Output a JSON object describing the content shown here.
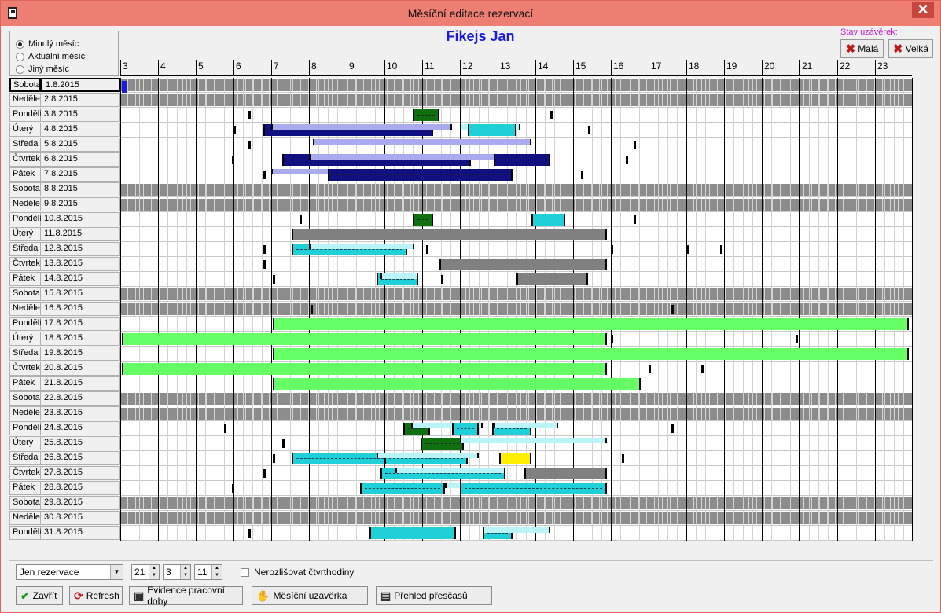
{
  "window": {
    "title": "Měsíční editace rezervací",
    "close_label": "✕"
  },
  "period": {
    "options": [
      {
        "label": "Minulý měsíc",
        "selected": true
      },
      {
        "label": "Aktuální měsíc",
        "selected": false
      },
      {
        "label": "Jiný měsíc",
        "selected": false
      }
    ]
  },
  "person": "Fikejs Jan",
  "closure": {
    "label": "Stav uzávěrek:",
    "small_label": "Malá",
    "big_label": "Velká"
  },
  "hours": [
    "3",
    "4",
    "5",
    "6",
    "7",
    "8",
    "9",
    "10",
    "11",
    "12",
    "13",
    "14",
    "15",
    "16",
    "17",
    "18",
    "19",
    "20",
    "21",
    "22",
    "23"
  ],
  "days": [
    {
      "name": "Sobota",
      "date": "1.8.2015",
      "weekend": true,
      "selected": true
    },
    {
      "name": "Neděle",
      "date": "2.8.2015",
      "weekend": true
    },
    {
      "name": "Pondělí",
      "date": "3.8.2015"
    },
    {
      "name": "Úterý",
      "date": "4.8.2015"
    },
    {
      "name": "Středa",
      "date": "5.8.2015"
    },
    {
      "name": "Čtvrtek",
      "date": "6.8.2015"
    },
    {
      "name": "Pátek",
      "date": "7.8.2015"
    },
    {
      "name": "Sobota",
      "date": "8.8.2015",
      "weekend": true
    },
    {
      "name": "Neděle",
      "date": "9.8.2015",
      "weekend": true
    },
    {
      "name": "Pondělí",
      "date": "10.8.2015"
    },
    {
      "name": "Úterý",
      "date": "11.8.2015"
    },
    {
      "name": "Středa",
      "date": "12.8.2015"
    },
    {
      "name": "Čtvrtek",
      "date": "13.8.2015"
    },
    {
      "name": "Pátek",
      "date": "14.8.2015"
    },
    {
      "name": "Sobota",
      "date": "15.8.2015",
      "weekend": true
    },
    {
      "name": "Neděle",
      "date": "16.8.2015",
      "weekend": true
    },
    {
      "name": "Pondělí",
      "date": "17.8.2015"
    },
    {
      "name": "Úterý",
      "date": "18.8.2015"
    },
    {
      "name": "Středa",
      "date": "19.8.2015"
    },
    {
      "name": "Čtvrtek",
      "date": "20.8.2015"
    },
    {
      "name": "Pátek",
      "date": "21.8.2015"
    },
    {
      "name": "Sobota",
      "date": "22.8.2015",
      "weekend": true
    },
    {
      "name": "Neděle",
      "date": "23.8.2015",
      "weekend": true
    },
    {
      "name": "Pondělí",
      "date": "24.8.2015"
    },
    {
      "name": "Úterý",
      "date": "25.8.2015"
    },
    {
      "name": "Středa",
      "date": "26.8.2015"
    },
    {
      "name": "Čtvrtek",
      "date": "27.8.2015"
    },
    {
      "name": "Pátek",
      "date": "28.8.2015"
    },
    {
      "name": "Sobota",
      "date": "29.8.2015",
      "weekend": true
    },
    {
      "name": "Neděle",
      "date": "30.8.2015",
      "weekend": true
    },
    {
      "name": "Pondělí",
      "date": "31.8.2015"
    }
  ],
  "colors": {
    "weekend": "#8c8c8c",
    "reservation": "#101080",
    "reservation_light": "#aaaaee",
    "closure": "#808080",
    "cyan": "#20d0d8",
    "cyan_light": "#b8f4f8",
    "green_dark": "#107010",
    "green_light": "#66ff66",
    "yellow": "#ffee00"
  },
  "bars": [
    {
      "day": 2,
      "from": 10.75,
      "to": 11.45,
      "color": "#107010",
      "dashed": true
    },
    {
      "day": 3,
      "from": 6.8,
      "to": 11.3,
      "color": "#101080",
      "dashed": true
    },
    {
      "day": 3,
      "from": 7.0,
      "to": 11.8,
      "color": "#aaaaee",
      "thin": true
    },
    {
      "day": 3,
      "from": 12.0,
      "to": 13.6,
      "color": "#b8f4f8",
      "thin": true
    },
    {
      "day": 3,
      "from": 12.2,
      "to": 13.5,
      "color": "#20d0d8",
      "dashed": true
    },
    {
      "day": 4,
      "from": 8.1,
      "to": 13.9,
      "color": "#aaaaee",
      "thin": true
    },
    {
      "day": 5,
      "from": 7.3,
      "to": 12.3,
      "color": "#101080",
      "dashed": true
    },
    {
      "day": 5,
      "from": 8.0,
      "to": 13.9,
      "color": "#aaaaee",
      "thin": true
    },
    {
      "day": 5,
      "from": 12.9,
      "to": 14.4,
      "color": "#101080"
    },
    {
      "day": 6,
      "from": 7.0,
      "to": 12.0,
      "color": "#aaaaee",
      "thin": true
    },
    {
      "day": 6,
      "from": 8.5,
      "to": 13.4,
      "color": "#101080",
      "dashed": true
    },
    {
      "day": 9,
      "from": 10.75,
      "to": 11.3,
      "color": "#107010",
      "dashed": true
    },
    {
      "day": 9,
      "from": 13.9,
      "to": 14.8,
      "color": "#20d0d8"
    },
    {
      "day": 10,
      "from": 7.55,
      "to": 15.9,
      "color": "#808080"
    },
    {
      "day": 11,
      "from": 7.55,
      "to": 10.6,
      "color": "#20d0d8",
      "dashed": true
    },
    {
      "day": 11,
      "from": 8.0,
      "to": 10.8,
      "color": "#b8f4f8",
      "thin": true
    },
    {
      "day": 12,
      "from": 11.45,
      "to": 15.9,
      "color": "#808080"
    },
    {
      "day": 13,
      "from": 9.8,
      "to": 10.9,
      "color": "#20d0d8",
      "dashed": true
    },
    {
      "day": 13,
      "from": 9.9,
      "to": 10.9,
      "color": "#b8f4f8",
      "thin": true
    },
    {
      "day": 13,
      "from": 13.5,
      "to": 15.4,
      "color": "#808080"
    },
    {
      "day": 16,
      "from": 7.05,
      "to": 23.9,
      "color": "#66ff66"
    },
    {
      "day": 17,
      "from": 3.05,
      "to": 15.9,
      "color": "#66ff66"
    },
    {
      "day": 18,
      "from": 7.05,
      "to": 23.9,
      "color": "#66ff66"
    },
    {
      "day": 19,
      "from": 3.05,
      "to": 15.9,
      "color": "#66ff66"
    },
    {
      "day": 20,
      "from": 7.05,
      "to": 16.8,
      "color": "#66ff66"
    },
    {
      "day": 23,
      "from": 10.5,
      "to": 11.2,
      "color": "#107010",
      "dashed": true
    },
    {
      "day": 23,
      "from": 10.7,
      "to": 12.6,
      "color": "#b8f4f8",
      "thin": true
    },
    {
      "day": 23,
      "from": 11.8,
      "to": 12.5,
      "color": "#20d0d8",
      "dashed": true
    },
    {
      "day": 23,
      "from": 12.85,
      "to": 13.9,
      "color": "#20d0d8",
      "dashed": true
    },
    {
      "day": 23,
      "from": 12.9,
      "to": 14.6,
      "color": "#b8f4f8",
      "thin": true
    },
    {
      "day": 24,
      "from": 10.95,
      "to": 12.1,
      "color": "#107010",
      "dashed": true
    },
    {
      "day": 24,
      "from": 12.0,
      "to": 15.9,
      "color": "#b8f4f8",
      "thin": true
    },
    {
      "day": 25,
      "from": 7.55,
      "to": 10.1,
      "color": "#20d0d8",
      "dashed": true
    },
    {
      "day": 25,
      "from": 10.0,
      "to": 12.2,
      "color": "#20d0d8",
      "dashed": true
    },
    {
      "day": 25,
      "from": 9.8,
      "to": 12.5,
      "color": "#b8f4f8",
      "thin": true
    },
    {
      "day": 25,
      "from": 13.05,
      "to": 13.9,
      "color": "#ffee00"
    },
    {
      "day": 26,
      "from": 9.9,
      "to": 13.2,
      "color": "#20d0d8",
      "dashed": true
    },
    {
      "day": 26,
      "from": 10.3,
      "to": 13.2,
      "color": "#b8f4f8",
      "thin": true
    },
    {
      "day": 26,
      "from": 13.7,
      "to": 15.9,
      "color": "#808080"
    },
    {
      "day": 27,
      "from": 9.35,
      "to": 11.6,
      "color": "#20d0d8",
      "dashed": true
    },
    {
      "day": 27,
      "from": 11.6,
      "to": 13.9,
      "color": "#b8f4f8",
      "thin": true
    },
    {
      "day": 27,
      "from": 12.0,
      "to": 15.9,
      "color": "#20d0d8",
      "dashed": true
    },
    {
      "day": 30,
      "from": 9.6,
      "to": 11.9,
      "color": "#20d0d8"
    },
    {
      "day": 30,
      "from": 12.6,
      "to": 13.4,
      "color": "#20d0d8",
      "dashed": true
    },
    {
      "day": 30,
      "from": 12.6,
      "to": 14.4,
      "color": "#b8f4f8",
      "thin": true
    }
  ],
  "marks": [
    {
      "day": 0,
      "at": 3.05,
      "color": "#1a1ae6"
    },
    {
      "day": 2,
      "at": 6.4
    },
    {
      "day": 2,
      "at": 14.4
    },
    {
      "day": 3,
      "at": 6.0
    },
    {
      "day": 3,
      "at": 15.4
    },
    {
      "day": 4,
      "at": 6.4
    },
    {
      "day": 4,
      "at": 16.6
    },
    {
      "day": 5,
      "at": 5.95
    },
    {
      "day": 5,
      "at": 16.4
    },
    {
      "day": 6,
      "at": 6.8
    },
    {
      "day": 6,
      "at": 15.2
    },
    {
      "day": 9,
      "at": 7.75
    },
    {
      "day": 9,
      "at": 16.6
    },
    {
      "day": 11,
      "at": 6.8
    },
    {
      "day": 11,
      "at": 11.1
    },
    {
      "day": 11,
      "at": 16.0
    },
    {
      "day": 11,
      "at": 18.0
    },
    {
      "day": 11,
      "at": 18.9
    },
    {
      "day": 12,
      "at": 6.8
    },
    {
      "day": 13,
      "at": 7.05
    },
    {
      "day": 13,
      "at": 11.5
    },
    {
      "day": 15,
      "at": 8.05
    },
    {
      "day": 15,
      "at": 17.6
    },
    {
      "day": 17,
      "at": 16.0
    },
    {
      "day": 17,
      "at": 20.9
    },
    {
      "day": 19,
      "at": 17.0
    },
    {
      "day": 19,
      "at": 18.4
    },
    {
      "day": 23,
      "at": 5.75
    },
    {
      "day": 23,
      "at": 17.6
    },
    {
      "day": 24,
      "at": 7.3
    },
    {
      "day": 25,
      "at": 7.05
    },
    {
      "day": 25,
      "at": 16.3
    },
    {
      "day": 26,
      "at": 6.8
    },
    {
      "day": 27,
      "at": 5.95
    },
    {
      "day": 30,
      "at": 6.4
    }
  ],
  "controls": {
    "view": "Jen rezervace",
    "spin1": "21",
    "spin2": "3",
    "spin3": "11",
    "check_label": "Nerozlišovat čtvrthodiny",
    "close": "Zavřít",
    "refresh": "Refresh",
    "attendance": "Evidence pracovní doby",
    "monthly": "Měsíční uzávěrka",
    "overtime": "Přehled přesčasů"
  }
}
